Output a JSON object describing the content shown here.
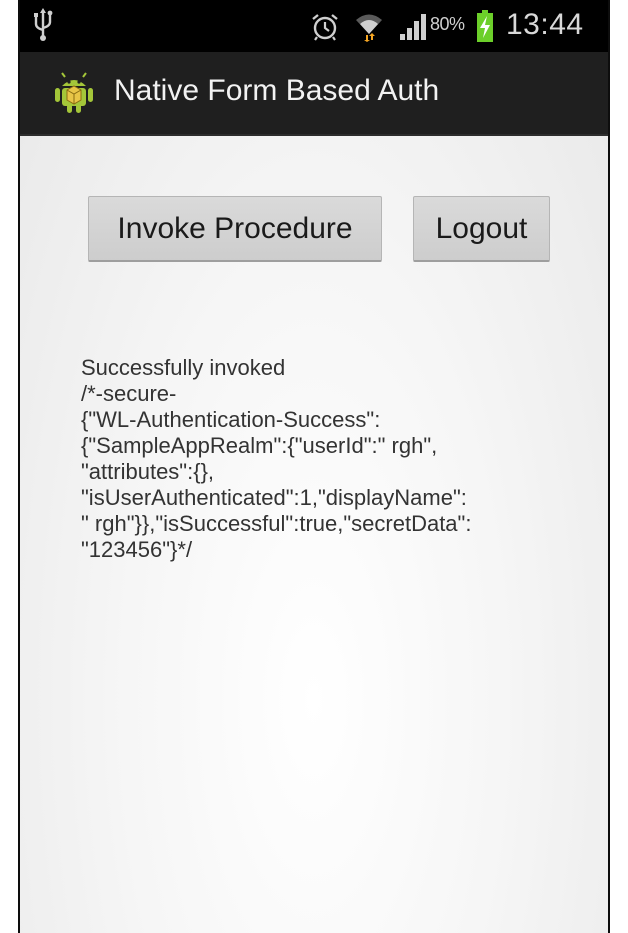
{
  "status_bar": {
    "battery_percent": "80%",
    "time": "13:44",
    "icons": [
      "usb-icon",
      "alarm-icon",
      "wifi-icon",
      "signal-icon",
      "battery-charging-icon"
    ]
  },
  "action_bar": {
    "app_icon": "android-app-icon",
    "title": "Native Form Based Auth"
  },
  "buttons": {
    "invoke_label": "Invoke Procedure",
    "logout_label": "Logout"
  },
  "result": {
    "text": "Successfully invoked\n/*-secure-\n{\"WL-Authentication-Success\":\n{\"SampleAppRealm\":{\"userId\":\" rgh\",\n\"attributes\":{},\n\"isUserAuthenticated\":1,\"displayName\":\n\" rgh\"}},\"isSuccessful\":true,\"secretData\":\n\"123456\"}*/"
  },
  "colors": {
    "status_bar_bg": "#000000",
    "action_bar_bg": "#1f1f1f",
    "button_bg": "#d4d4d4",
    "battery_green": "#6ccf2a",
    "wifi_activity": "#f5a623"
  }
}
